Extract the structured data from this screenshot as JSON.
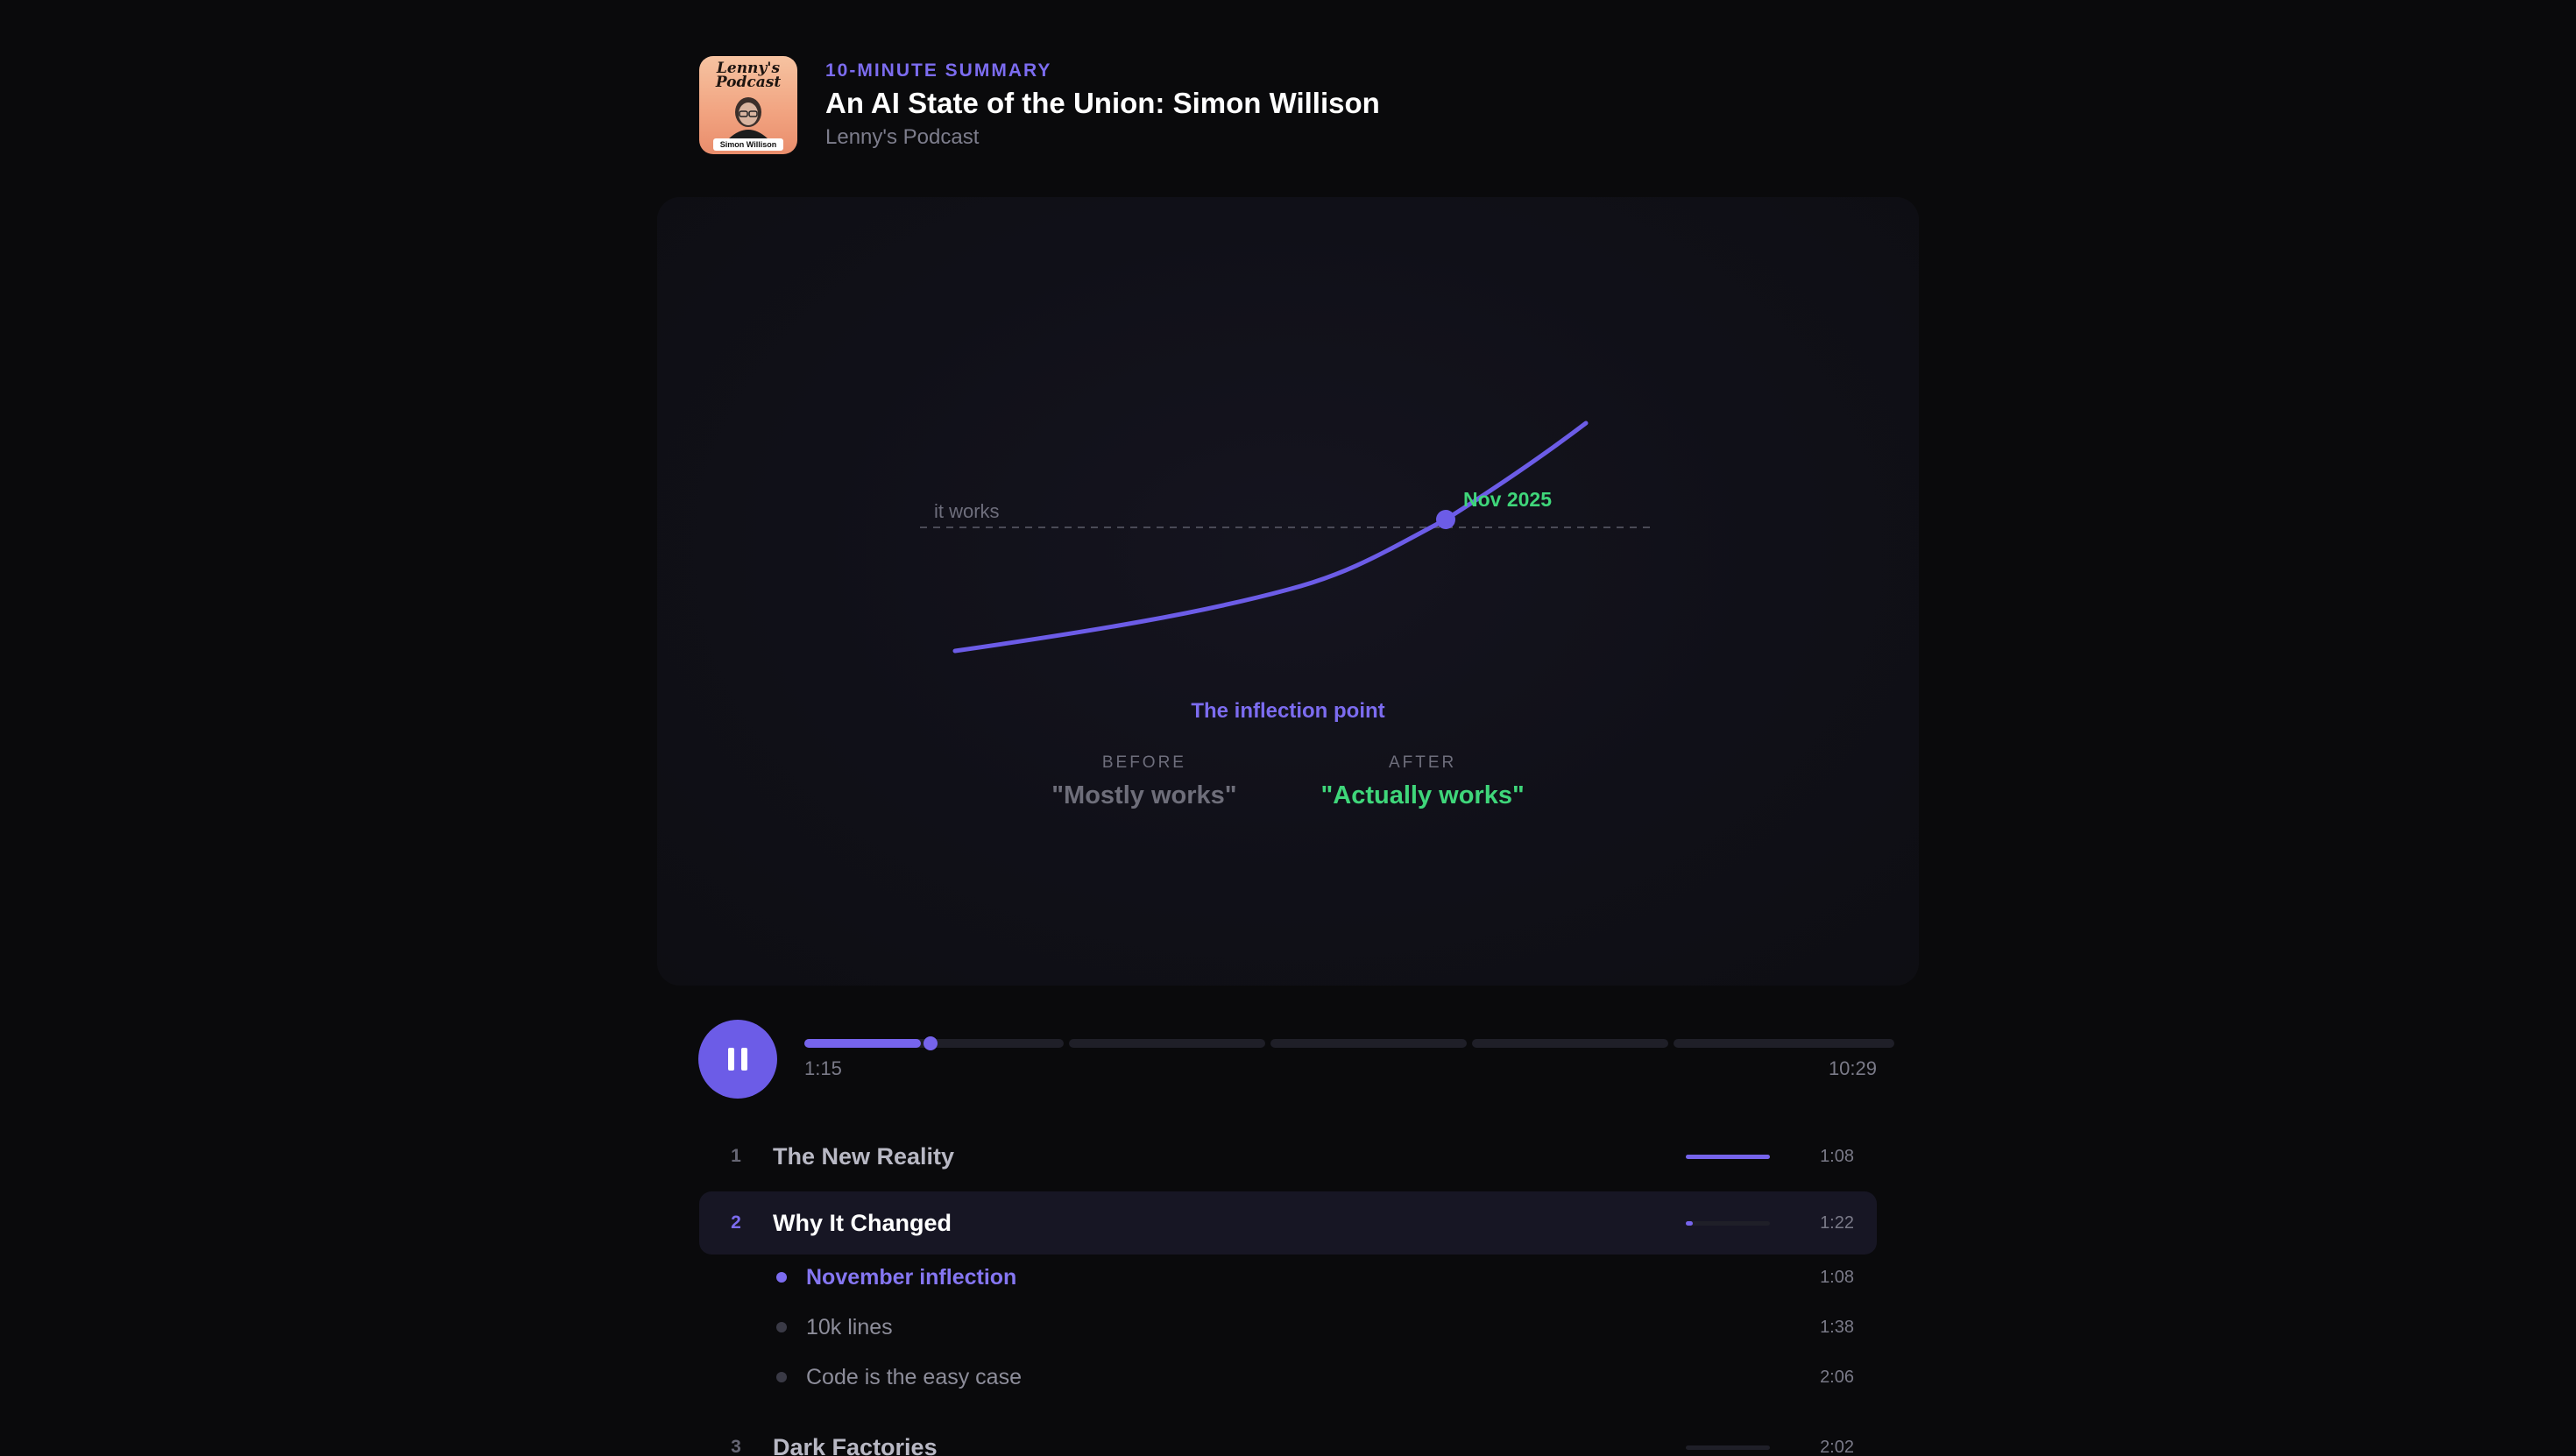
{
  "header": {
    "eyebrow": "10-MINUTE SUMMARY",
    "title": "An AI State of the Union: Simon Willison",
    "show": "Lenny's Podcast",
    "cover": {
      "title_line1": "Lenny's",
      "title_line2": "Podcast",
      "guest_tag": "Simon Willison"
    }
  },
  "visual": {
    "threshold_label": "it works",
    "point_label": "Nov 2025",
    "caption": "The inflection point",
    "before_label": "BEFORE",
    "before_quote": "\"Mostly works\"",
    "after_label": "AFTER",
    "after_quote": "\"Actually works\""
  },
  "player": {
    "state": "playing",
    "current_time": "1:15",
    "total_time": "10:29",
    "progress_fraction": 0.12
  },
  "chapters": [
    {
      "num": "1",
      "title": "The New Reality",
      "duration": "1:08",
      "progress": 1.0,
      "active": false
    },
    {
      "num": "2",
      "title": "Why It Changed",
      "duration": "1:22",
      "progress": 0.08,
      "active": true,
      "subs": [
        {
          "title": "November inflection",
          "duration": "1:08",
          "current": true
        },
        {
          "title": "10k lines",
          "duration": "1:38",
          "current": false
        },
        {
          "title": "Code is the easy case",
          "duration": "2:06",
          "current": false
        }
      ]
    },
    {
      "num": "3",
      "title": "Dark Factories",
      "duration": "2:02",
      "progress": 0,
      "active": false
    }
  ],
  "colors": {
    "accent": "#6c5ce7",
    "success": "#3fd67a",
    "background": "#0a0a0c"
  }
}
